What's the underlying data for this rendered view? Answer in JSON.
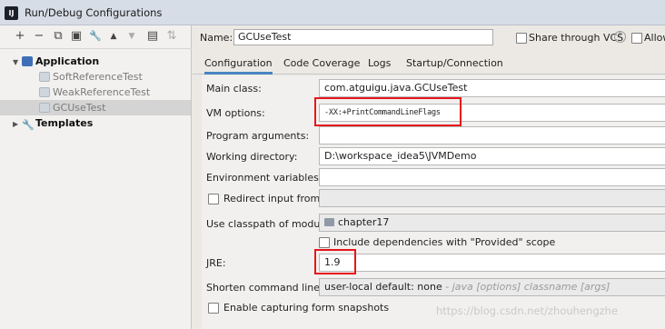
{
  "window": {
    "title": "Run/Debug Configurations",
    "app_icon_text": "IJ"
  },
  "toolbar": {
    "buttons": [
      {
        "name": "add-icon",
        "glyph": "+"
      },
      {
        "name": "remove-icon",
        "glyph": "−"
      },
      {
        "name": "copy-icon",
        "glyph": "⧉"
      },
      {
        "name": "save-icon",
        "glyph": "▣"
      },
      {
        "name": "wrench-icon",
        "glyph": "🔧"
      },
      {
        "name": "move-up-icon",
        "glyph": "▲"
      },
      {
        "name": "move-down-icon",
        "glyph": "▼"
      },
      {
        "name": "folder-icon",
        "glyph": "▤"
      },
      {
        "name": "sort-icon",
        "glyph": "⇅"
      }
    ]
  },
  "tree": {
    "application": "Application",
    "children": [
      "SoftReferenceTest",
      "WeakReferenceTest",
      "GCUseTest"
    ],
    "templates": "Templates"
  },
  "header": {
    "name_label": "Name:",
    "name_value": "GCUseTest",
    "share_label": "Share through VCS",
    "help_glyph": "?",
    "allow_label": "Allow"
  },
  "tabs": [
    "Configuration",
    "Code Coverage",
    "Logs",
    "Startup/Connection"
  ],
  "form": {
    "main_class_label": "Main class:",
    "main_class_value": "com.atguigu.java.GCUseTest",
    "vm_options_label": "VM options:",
    "vm_options_value": "-XX:+PrintCommandLineFlags",
    "program_args_label": "Program arguments:",
    "working_dir_label": "Working directory:",
    "working_dir_value": "D:\\workspace_idea5\\JVMDemo",
    "env_vars_label": "Environment variables:",
    "redirect_label": "Redirect input from:",
    "classpath_label": "Use classpath of module:",
    "classpath_value": "chapter17",
    "include_deps_label": "Include dependencies with \"Provided\" scope",
    "jre_label": "JRE:",
    "jre_value": "1.9",
    "shorten_label": "Shorten command line:",
    "shorten_value": "user-local default: none",
    "shorten_hint": " - java [options] classname [args]",
    "capture_label": "Enable capturing form snapshots"
  },
  "watermark": "https://blog.csdn.net/zhouhengzhe",
  "colors": {
    "highlight": "#e8141b",
    "active_tab": "#4a83c4"
  }
}
